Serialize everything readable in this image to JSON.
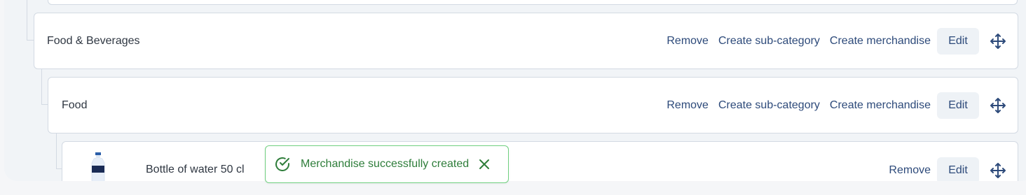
{
  "categories": [
    {
      "title": "Food & Beverages",
      "actions": {
        "remove": "Remove",
        "create_sub": "Create sub-category",
        "create_merch": "Create merchandise",
        "edit": "Edit"
      }
    },
    {
      "title": "Food",
      "actions": {
        "remove": "Remove",
        "create_sub": "Create sub-category",
        "create_merch": "Create merchandise",
        "edit": "Edit"
      }
    }
  ],
  "merchandise": [
    {
      "title": "Bottle of water 50 cl",
      "actions": {
        "remove": "Remove",
        "edit": "Edit"
      }
    }
  ],
  "toast": {
    "message": "Merchandise successfully created",
    "icon": "check-circle-icon",
    "close_icon": "close-icon"
  },
  "colors": {
    "accent_text": "#2d4a7a",
    "success": "#2e7d3a",
    "success_border": "#6fcf7f"
  }
}
